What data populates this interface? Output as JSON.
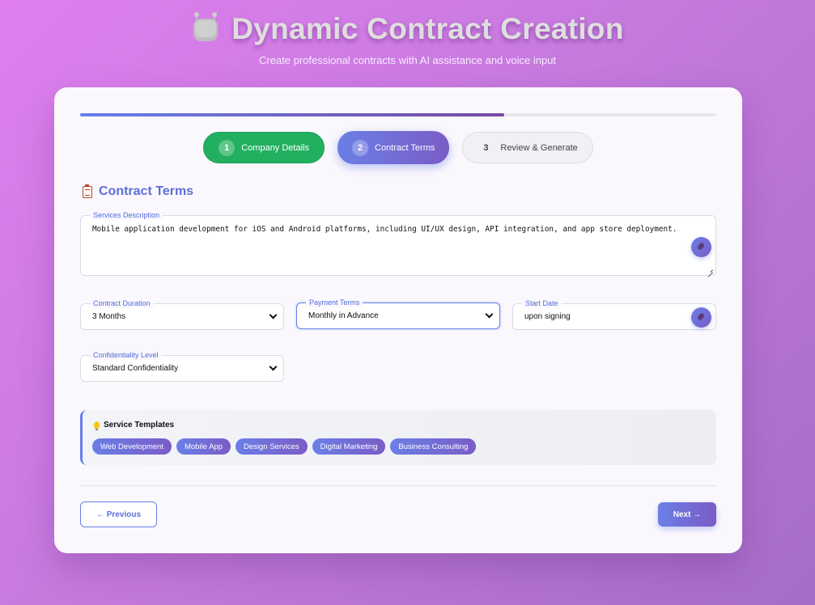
{
  "header": {
    "title": "Dynamic Contract Creation",
    "subtitle": "Create professional contracts with AI assistance and voice input",
    "icon": "robot-icon"
  },
  "progress": {
    "value": 0.667
  },
  "steps": [
    {
      "number": "1",
      "label": "Company Details",
      "status": "done"
    },
    {
      "number": "2",
      "label": "Contract Terms",
      "status": "active"
    },
    {
      "number": "3",
      "label": "Review & Generate",
      "status": "pending"
    }
  ],
  "section": {
    "title": "Contract Terms",
    "icon": "clipboard-icon"
  },
  "fields": {
    "services": {
      "label": "Services Description",
      "value": "Mobile application development for iOS and Android platforms, including UI/UX design, API integration, and app store deployment."
    },
    "duration": {
      "label": "Contract Duration",
      "value": "3 Months"
    },
    "payment": {
      "label": "Payment Terms",
      "value": "Monthly in Advance"
    },
    "start_date": {
      "label": "Start Date",
      "value": "upon signing"
    },
    "confidentiality": {
      "label": "Confidentiality Level",
      "value": "Standard Confidentiality"
    }
  },
  "templates": {
    "title": "Service Templates",
    "icon": "lightbulb-icon",
    "items": [
      "Web Development",
      "Mobile App",
      "Design Services",
      "Digital Marketing",
      "Business Consulting"
    ]
  },
  "nav": {
    "previous_label": "← Previous",
    "next_label": "Next →"
  },
  "colors": {
    "accent": "#667eea",
    "accent_secondary": "#764ba2",
    "success": "#22b060"
  }
}
